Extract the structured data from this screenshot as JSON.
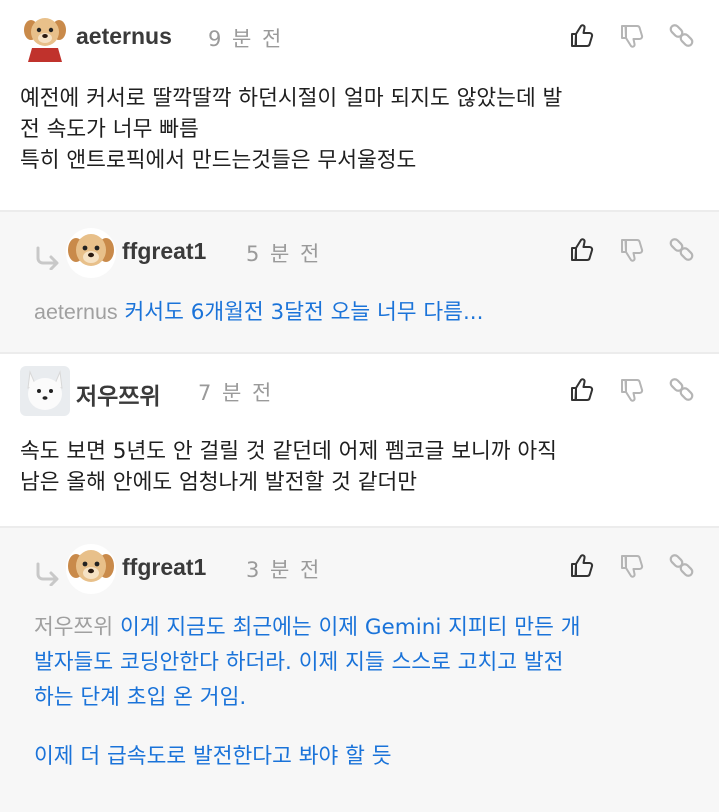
{
  "comments": [
    {
      "author": "aeternus",
      "time": "9 분 전",
      "avatar": "puppy-avatar",
      "text": "예전에 커서로 딸깍딸깍 하던시절이 얼마 되지도 않았는데 발\n전 속도가 너무 빠름\n특히 앤트로픽에서 만드는것들은 무서울정도"
    },
    {
      "author": "ffgreat1",
      "time": "5 분 전",
      "avatar": "puppy-avatar",
      "mention": "aeternus",
      "text": "커서도 6개월전 3달전 오늘 너무 다름..."
    },
    {
      "author": "저우쯔위",
      "time": "7 분 전",
      "avatar": "white-fox-avatar",
      "text": "속도 보면 5년도 안 걸릴 것 같던데 어제 펨코글 보니까 아직\n남은 올해 안에도 엄청나게 발전할 것 같더만"
    },
    {
      "author": "ffgreat1",
      "time": "3 분 전",
      "avatar": "puppy-avatar",
      "mention": "저우쯔위",
      "text_line1": "이게 지금도 최근에는 이제 Gemini 지피티 만든 개",
      "text_line2": "발자들도 코딩안한다 하더라. 이제 지들 스스로 고치고 발전",
      "text_line3": "하는 단계 초입 온 거임.",
      "text_line4": "이제 더 급속도로 발전한다고 봐야 할 듯"
    }
  ],
  "icons": {
    "like": "thumbs-up-icon",
    "dislike": "thumbs-down-icon",
    "share": "link-icon",
    "reply": "reply-arrow-icon"
  },
  "colors": {
    "link_blue": "#1a73d9",
    "mention_gray": "#a0a0a0",
    "reply_bg": "#f7f7f7"
  }
}
